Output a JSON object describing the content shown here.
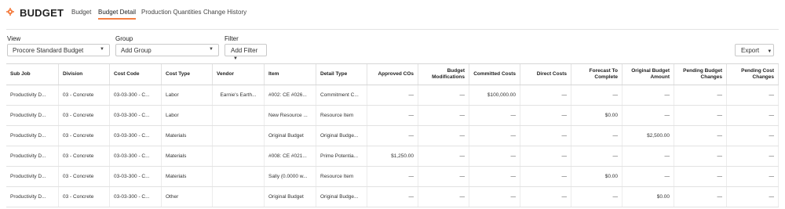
{
  "header": {
    "title": "BUDGET",
    "icon": "gear-icon",
    "accent_color": "#f47e42",
    "tabs": [
      {
        "label": "Budget",
        "active": false
      },
      {
        "label": "Budget Detail",
        "active": true
      },
      {
        "label": "Production Quantities",
        "active": false
      },
      {
        "label": "Change History",
        "active": false
      }
    ]
  },
  "filters": {
    "view_label": "View",
    "view_value": "Procore Standard Budget",
    "group_label": "Group",
    "group_value": "Add Group",
    "filter_label": "Filter",
    "filter_button": "Add Filter",
    "export_button": "Export"
  },
  "table": {
    "columns": [
      "Sub Job",
      "Division",
      "Cost Code",
      "Cost Type",
      "Vendor",
      "Item",
      "Detail Type",
      "Approved COs",
      "Budget Modifications",
      "Committed Costs",
      "Direct Costs",
      "Forecast To Complete",
      "Original Budget Amount",
      "Pending Budget Changes",
      "Pending Cost Changes"
    ],
    "rows": [
      [
        "Productivity D...",
        "03 - Concrete",
        "03-03-300 - C...",
        "Labor",
        "Earnie's Earth...",
        "#002: CE #026...",
        "Commitment C...",
        "—",
        "—",
        "$100,000.00",
        "—",
        "—",
        "—",
        "—",
        "—"
      ],
      [
        "Productivity D...",
        "03 - Concrete",
        "03-03-300 - C...",
        "Labor",
        "",
        "New Resource ...",
        "Resource Item",
        "—",
        "—",
        "—",
        "—",
        "$0.00",
        "—",
        "—",
        "—"
      ],
      [
        "Productivity D...",
        "03 - Concrete",
        "03-03-300 - C...",
        "Materials",
        "",
        "Original Budget",
        "Original Budge...",
        "—",
        "—",
        "—",
        "—",
        "—",
        "$2,500.00",
        "—",
        "—"
      ],
      [
        "Productivity D...",
        "03 - Concrete",
        "03-03-300 - C...",
        "Materials",
        "",
        "#008: CE #021...",
        "Prime Potentia...",
        "$1,250.00",
        "—",
        "—",
        "—",
        "—",
        "—",
        "—",
        "—"
      ],
      [
        "Productivity D...",
        "03 - Concrete",
        "03-03-300 - C...",
        "Materials",
        "",
        "Sally (0.0000 w...",
        "Resource Item",
        "—",
        "—",
        "—",
        "—",
        "$0.00",
        "—",
        "—",
        "—"
      ],
      [
        "Productivity D...",
        "03 - Concrete",
        "03-03-300 - C...",
        "Other",
        "",
        "Original Budget",
        "Original Budge...",
        "—",
        "—",
        "—",
        "—",
        "—",
        "$0.00",
        "—",
        "—"
      ]
    ]
  }
}
